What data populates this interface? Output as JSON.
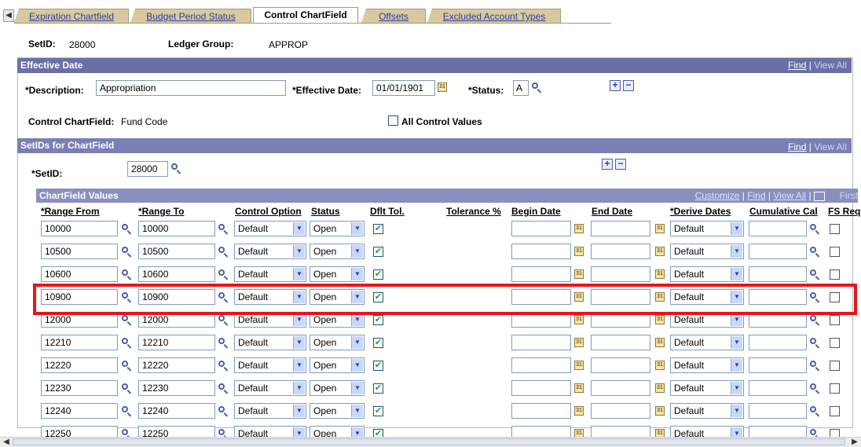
{
  "tabs": [
    {
      "label": "Expiration Chartfield",
      "active": false
    },
    {
      "label": "Budget Period Status",
      "active": false
    },
    {
      "label": "Control ChartField",
      "active": true
    },
    {
      "label": "Offsets",
      "active": false
    },
    {
      "label": "Excluded Account Types",
      "active": false
    }
  ],
  "header": {
    "setid_label": "SetID:",
    "setid_value": "28000",
    "ledger_group_label": "Ledger Group:",
    "ledger_group_value": "APPROP"
  },
  "effective_date_section": {
    "title": "Effective Date",
    "find": "Find",
    "separator": "|",
    "view_all": "View All",
    "description_label": "*Description:",
    "description_value": "Appropriation",
    "eff_date_label": "*Effective Date:",
    "eff_date_value": "01/01/1901",
    "status_label": "*Status:",
    "status_value": "A",
    "control_chartfield_label": "Control ChartField:",
    "control_chartfield_value": "Fund Code",
    "all_control_values_label": "All Control Values"
  },
  "setids_section": {
    "title": "SetIDs for ChartField",
    "find": "Find",
    "separator": "|",
    "view_all": "View All",
    "setid_label": "*SetID:",
    "setid_value": "28000"
  },
  "chartfield_values": {
    "title": "ChartField Values",
    "customize": "Customize",
    "find": "Find",
    "view_all": "View All",
    "first": "First",
    "columns": [
      "*Range From",
      "*Range To",
      "Control Option",
      "Status",
      "Dflt Tol.",
      "Tolerance %",
      "Begin Date",
      "End Date",
      "*Derive Dates",
      "Cumulative Cal",
      "FS Req"
    ],
    "rows": [
      {
        "from": "10000",
        "to": "10000",
        "control": "Default",
        "status": "Open",
        "dflt": true,
        "derive": "Default"
      },
      {
        "from": "10500",
        "to": "10500",
        "control": "Default",
        "status": "Open",
        "dflt": true,
        "derive": "Default"
      },
      {
        "from": "10600",
        "to": "10600",
        "control": "Default",
        "status": "Open",
        "dflt": true,
        "derive": "Default"
      },
      {
        "from": "10900",
        "to": "10900",
        "control": "Default",
        "status": "Open",
        "dflt": true,
        "derive": "Default"
      },
      {
        "from": "12000",
        "to": "12000",
        "control": "Default",
        "status": "Open",
        "dflt": true,
        "derive": "Default"
      },
      {
        "from": "12210",
        "to": "12210",
        "control": "Default",
        "status": "Open",
        "dflt": true,
        "derive": "Default"
      },
      {
        "from": "12220",
        "to": "12220",
        "control": "Default",
        "status": "Open",
        "dflt": true,
        "derive": "Default"
      },
      {
        "from": "12230",
        "to": "12230",
        "control": "Default",
        "status": "Open",
        "dflt": true,
        "derive": "Default"
      },
      {
        "from": "12240",
        "to": "12240",
        "control": "Default",
        "status": "Open",
        "dflt": true,
        "derive": "Default"
      },
      {
        "from": "12250",
        "to": "12250",
        "control": "Default",
        "status": "Open",
        "dflt": true,
        "derive": "Default"
      }
    ]
  },
  "colors": {
    "section_header": "#6a6fa6",
    "highlight_border": "#e8141a",
    "link": "#2a3ea8"
  }
}
